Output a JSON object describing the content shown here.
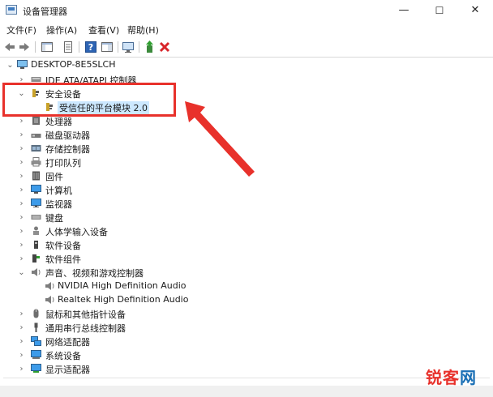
{
  "window": {
    "title": "设备管理器",
    "minimize": "—",
    "maximize": "☐",
    "close": "✕"
  },
  "menu": [
    "文件(F)",
    "操作(A)",
    "查看(V)",
    "帮助(H)"
  ],
  "tree": {
    "root": "DESKTOP-8E5SLCH",
    "items": [
      {
        "label": "IDE ATA/ATAPI 控制器",
        "expanded": false
      },
      {
        "label": "安全设备",
        "expanded": true
      },
      {
        "label": "受信任的平台模块 2.0",
        "child": true,
        "selected": true
      },
      {
        "label": "处理器",
        "expanded": false
      },
      {
        "label": "磁盘驱动器",
        "expanded": false
      },
      {
        "label": "存储控制器",
        "expanded": false
      },
      {
        "label": "打印队列",
        "expanded": false
      },
      {
        "label": "固件",
        "expanded": false
      },
      {
        "label": "计算机",
        "expanded": false
      },
      {
        "label": "监视器",
        "expanded": false
      },
      {
        "label": "键盘",
        "expanded": false
      },
      {
        "label": "人体学输入设备",
        "expanded": false
      },
      {
        "label": "软件设备",
        "expanded": false
      },
      {
        "label": "软件组件",
        "expanded": false
      },
      {
        "label": "声音、视频和游戏控制器",
        "expanded": true
      },
      {
        "label": "NVIDIA High Definition Audio",
        "child": true
      },
      {
        "label": "Realtek High Definition Audio",
        "child": true
      },
      {
        "label": "鼠标和其他指针设备",
        "expanded": false
      },
      {
        "label": "通用串行总线控制器",
        "expanded": false
      },
      {
        "label": "网络适配器",
        "expanded": false
      },
      {
        "label": "系统设备",
        "expanded": false
      },
      {
        "label": "显示适配器",
        "expanded": false
      }
    ]
  },
  "watermark": {
    "part1": "锐客",
    "part2": "网",
    "color1": "#e8312b",
    "color2": "#1a6fb5"
  },
  "colors": {
    "annotation": "#e8312b",
    "selection": "#cce8ff"
  }
}
